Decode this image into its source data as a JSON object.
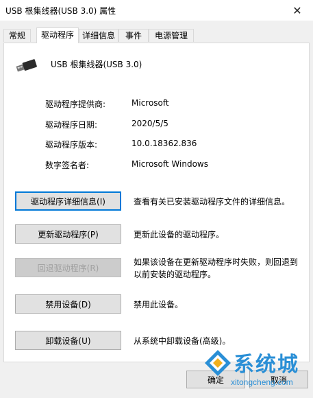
{
  "window": {
    "title": "USB 根集线器(USB 3.0) 属性"
  },
  "tabs": [
    {
      "label": "常规"
    },
    {
      "label": "驱动程序"
    },
    {
      "label": "详细信息"
    },
    {
      "label": "事件"
    },
    {
      "label": "电源管理"
    }
  ],
  "device": {
    "name": "USB 根集线器(USB 3.0)",
    "icon": "usb-plug-icon"
  },
  "properties": [
    {
      "label": "驱动程序提供商:",
      "value": "Microsoft"
    },
    {
      "label": "驱动程序日期:",
      "value": "2020/5/5"
    },
    {
      "label": "驱动程序版本:",
      "value": "10.0.18362.836"
    },
    {
      "label": "数字签名者:",
      "value": "Microsoft Windows"
    }
  ],
  "actions": [
    {
      "label": "驱动程序详细信息(I)",
      "desc": "查看有关已安装驱动程序文件的详细信息。"
    },
    {
      "label": "更新驱动程序(P)",
      "desc": "更新此设备的驱动程序。"
    },
    {
      "label": "回退驱动程序(R)",
      "desc": "如果该设备在更新驱动程序时失败，则回退到以前安装的驱动程序。"
    },
    {
      "label": "禁用设备(D)",
      "desc": "禁用此设备。"
    },
    {
      "label": "卸载设备(U)",
      "desc": "从系统中卸载设备(高级)。"
    }
  ],
  "footer": {
    "ok_label": "确定",
    "cancel_label": "取消"
  },
  "watermark": {
    "text": "系统城",
    "url": "xitongcheng.com"
  }
}
